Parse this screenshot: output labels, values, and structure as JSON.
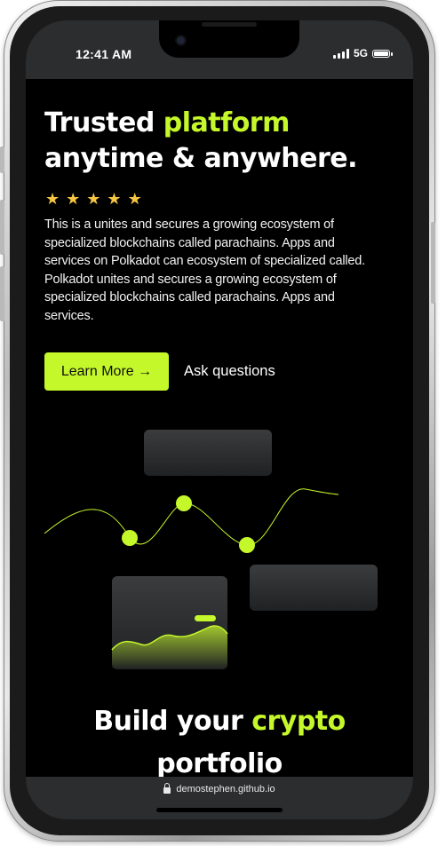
{
  "status_bar": {
    "time": "12:41 AM",
    "network": "5G"
  },
  "hero": {
    "title_part1": "Trusted ",
    "title_accent": "platform",
    "title_line2": "anytime & anywhere.",
    "rating_stars": 5,
    "description_p1": "This is a unites and secures a growing ecosystem of specialized blockchains called parachains. Apps and services on Polkadot can ecosystem of specialized called.",
    "description_p2": "Polkadot unites and secures a growing ecosystem of specialized blockchains called parachains. Apps and services."
  },
  "buttons": {
    "learn_more": "Learn More →",
    "ask_questions": "Ask questions"
  },
  "section2": {
    "title_part1": "Build your ",
    "title_accent": "crypto",
    "title_line2": "portfolio"
  },
  "url_bar": {
    "domain": "demostephen.github.io"
  },
  "colors": {
    "accent": "#c5f82a",
    "background": "#000000",
    "bars": "#2b2d2f",
    "star": "#f6c542"
  },
  "icons": [
    "signal-icon",
    "battery-icon",
    "star-icon",
    "arrow-right-icon",
    "lock-icon"
  ]
}
